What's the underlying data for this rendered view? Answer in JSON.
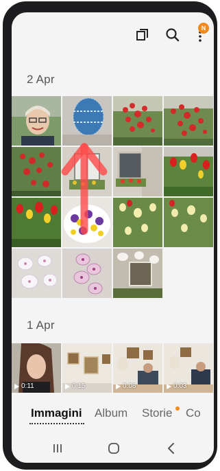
{
  "toolbar": {
    "icons": [
      "select-icon",
      "search-icon",
      "more-options-icon"
    ],
    "notification_badge": "N"
  },
  "sections": [
    {
      "date": "2 Apr"
    },
    {
      "date": "1 Apr"
    }
  ],
  "videos": [
    {
      "duration": "0:11"
    },
    {
      "duration": "0:15"
    },
    {
      "duration": "0:08"
    },
    {
      "duration": "0:03"
    }
  ],
  "tabs": {
    "items": [
      "Immagini",
      "Album",
      "Storie",
      "Co"
    ],
    "active": "Immagini"
  },
  "colors": {
    "accent": "#f08a1c",
    "swipe_arrow": "#ff4a4a"
  }
}
